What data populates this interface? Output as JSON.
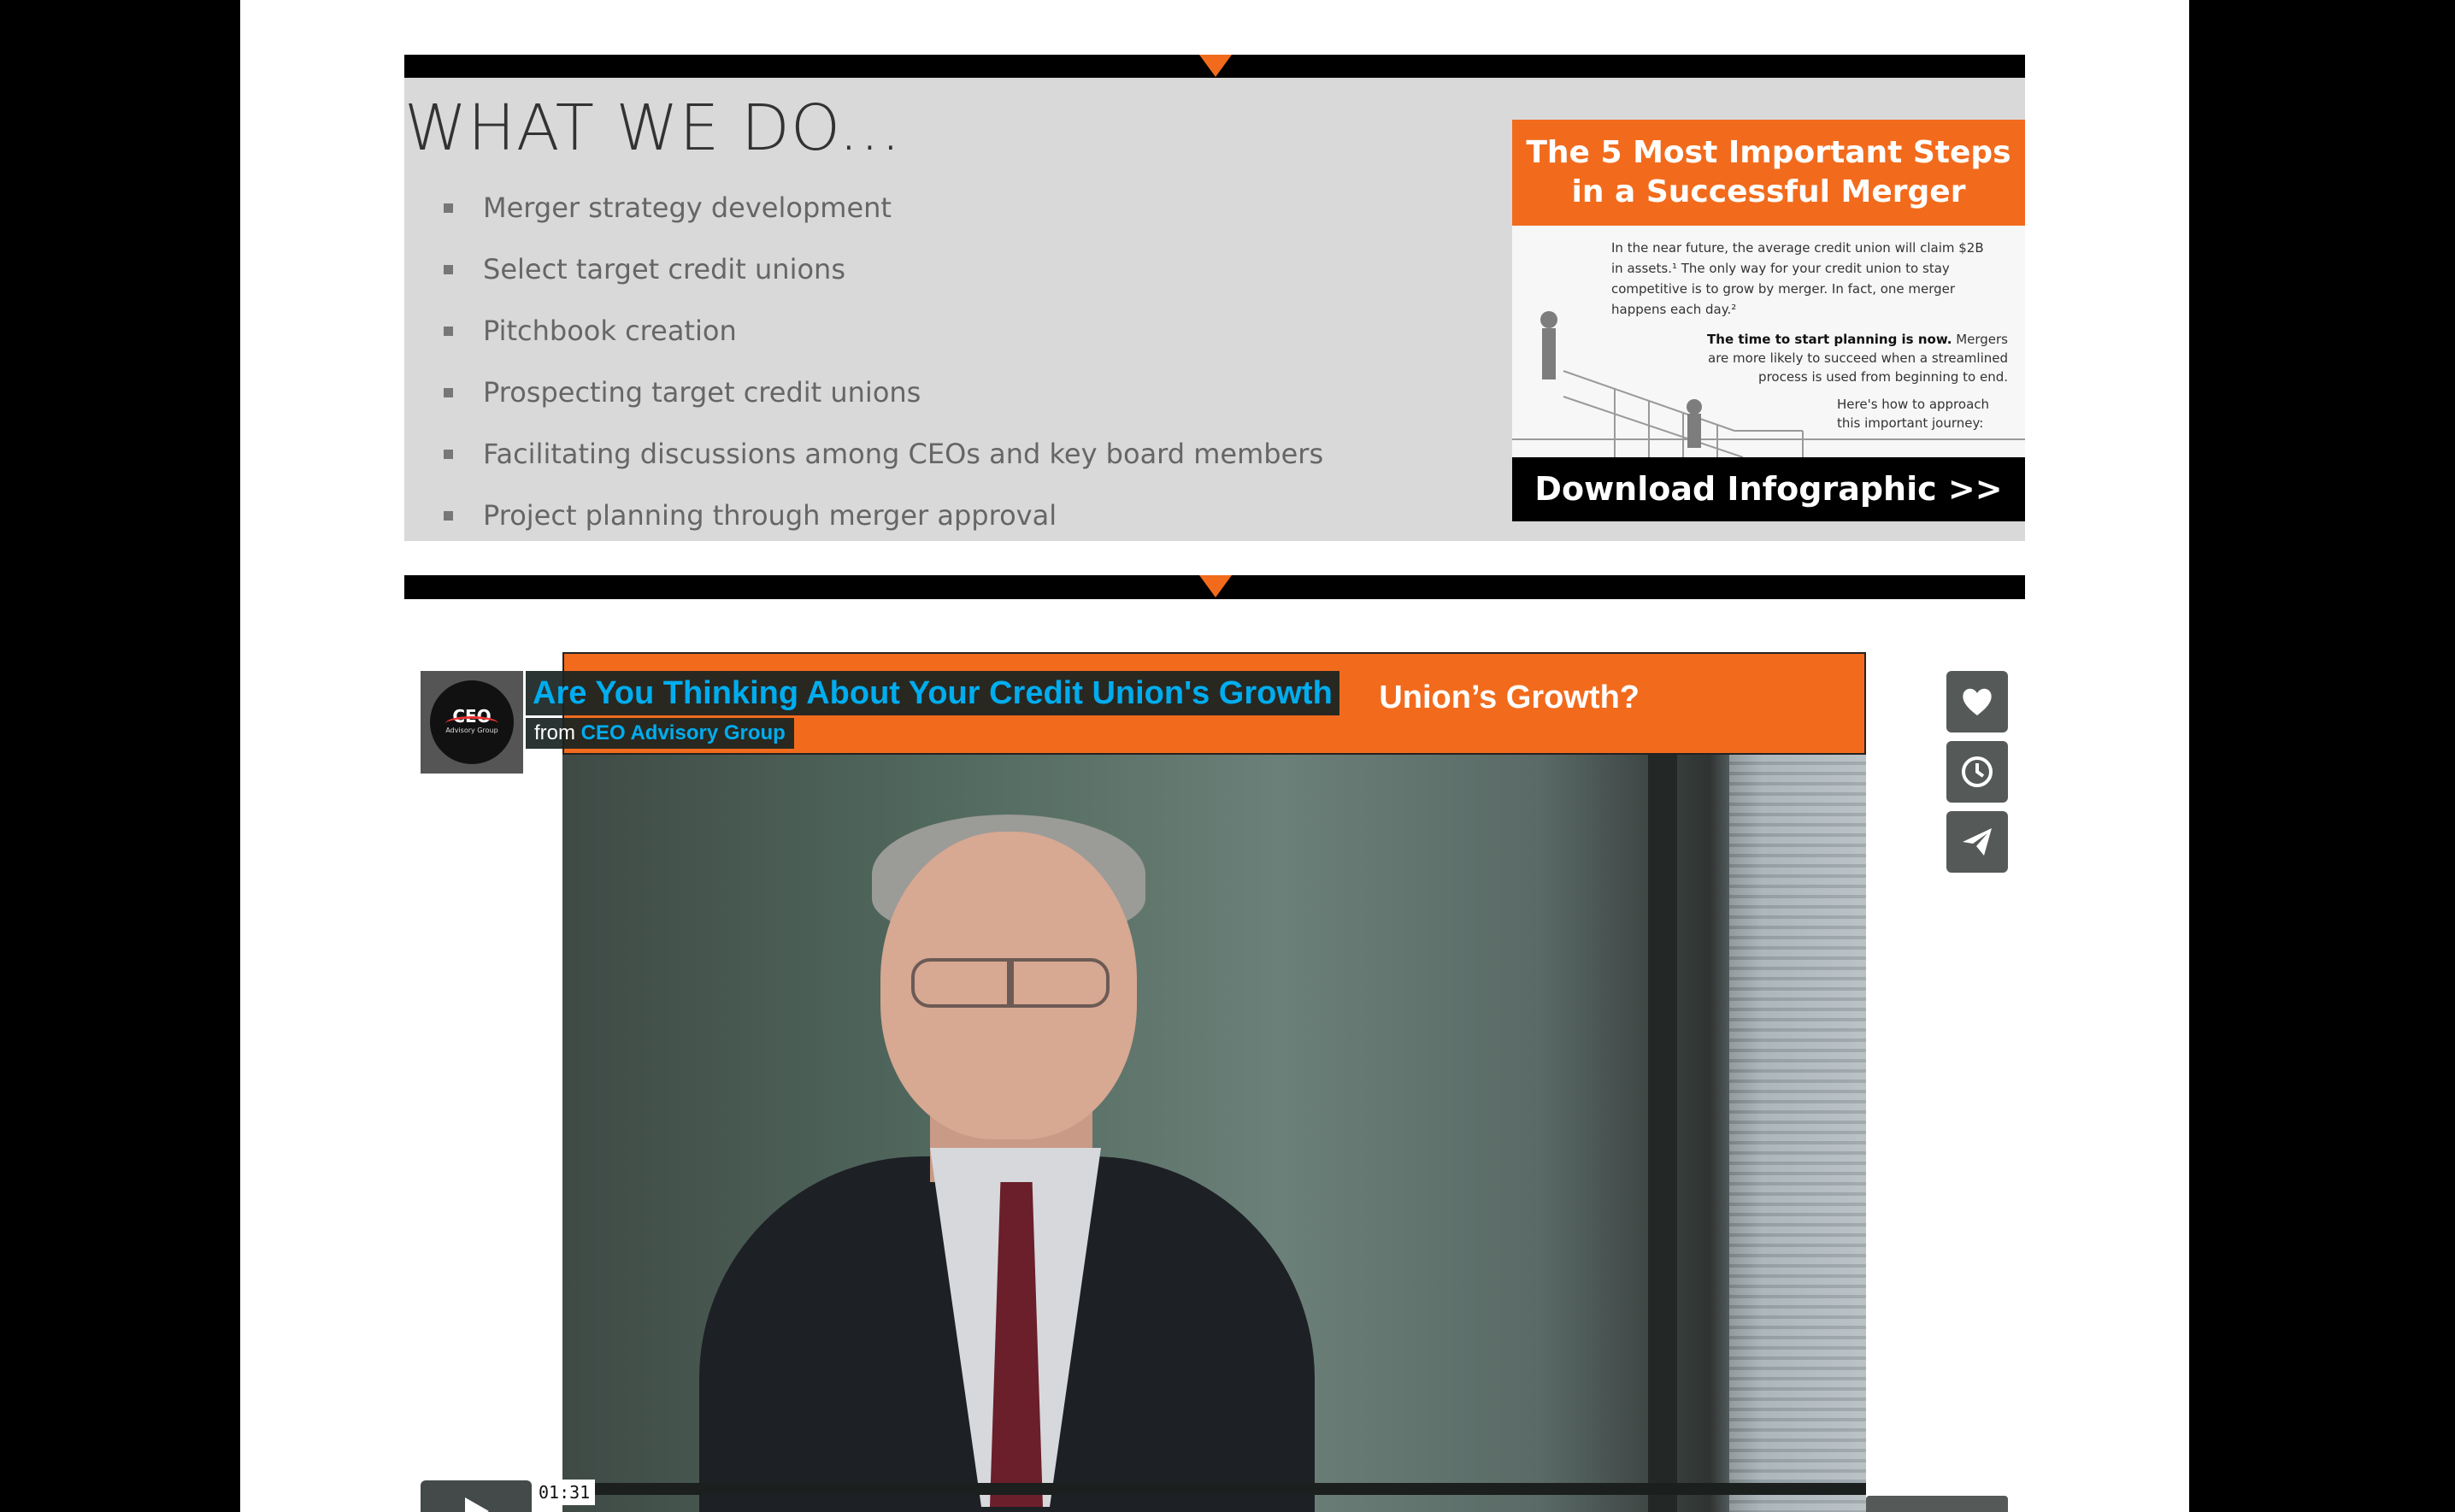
{
  "section": {
    "title": "WHAT WE DO...",
    "items": [
      "Merger strategy development",
      "Select target credit unions",
      "Pitchbook creation",
      "Prospecting target credit unions",
      "Facilitating discussions among CEOs and key board members",
      "Project planning through merger approval"
    ]
  },
  "promo": {
    "heading_line1": "The 5 Most Important Steps",
    "heading_line2": "in a Successful Merger",
    "body1": "In the near future, the average credit union will claim $2B in assets.¹ The only way for your credit union to stay competitive is to grow by merger. In fact, one merger happens each day.²",
    "body2_bold": "The time to start planning is now.",
    "body2_rest": " Mergers are more likely to succeed when a streamlined process is used from beginning to end.",
    "body3": "Here's how to approach this important journey:",
    "cta": "Download Infographic  >>"
  },
  "video": {
    "title": "Are You Thinking About Your Credit Union's Growth",
    "from_label": "from",
    "channel": "CEO Advisory Group",
    "banner_text": "Union’s Growth?",
    "logo_text": "CEO",
    "logo_subtext": "Advisory Group",
    "time": "01:31",
    "icons": [
      "heart-icon",
      "clock-icon",
      "send-icon",
      "play-icon"
    ]
  },
  "colors": {
    "accent": "#f26b1d",
    "link": "#00adef",
    "panel_bg": "#d9d9d9"
  }
}
